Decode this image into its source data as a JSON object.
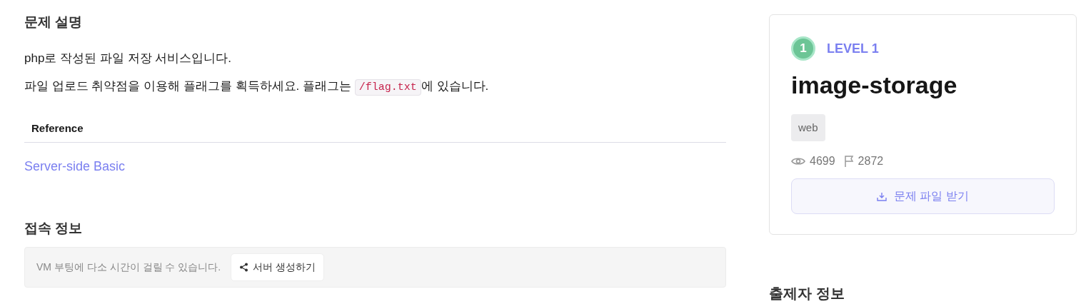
{
  "description": {
    "heading": "문제 설명",
    "paragraphs": [
      [
        {
          "kind": "text",
          "text": "php로 작성된 파일 저장 서비스입니다."
        }
      ],
      [
        {
          "kind": "text",
          "text": "파일 업로드 취약점을 이용해 플래그를 획득하세요. 플래그는 "
        },
        {
          "kind": "code",
          "text": "/flag.txt"
        },
        {
          "kind": "text",
          "text": "에 있습니다."
        }
      ]
    ],
    "reference": {
      "heading": "Reference",
      "links": [
        "Server-side Basic"
      ]
    }
  },
  "connection": {
    "heading": "접속 정보",
    "notice": "VM 부팅에 다소 시간이 걸릴 수 있습니다.",
    "button": "서버 생성하기"
  },
  "challenge": {
    "level_badge": "1",
    "level": "LEVEL 1",
    "title": "image-storage",
    "tags": [
      "web"
    ],
    "views": "4699",
    "solves": "2872",
    "download_button": "문제 파일 받기"
  },
  "author": {
    "heading": "출제자 정보"
  }
}
